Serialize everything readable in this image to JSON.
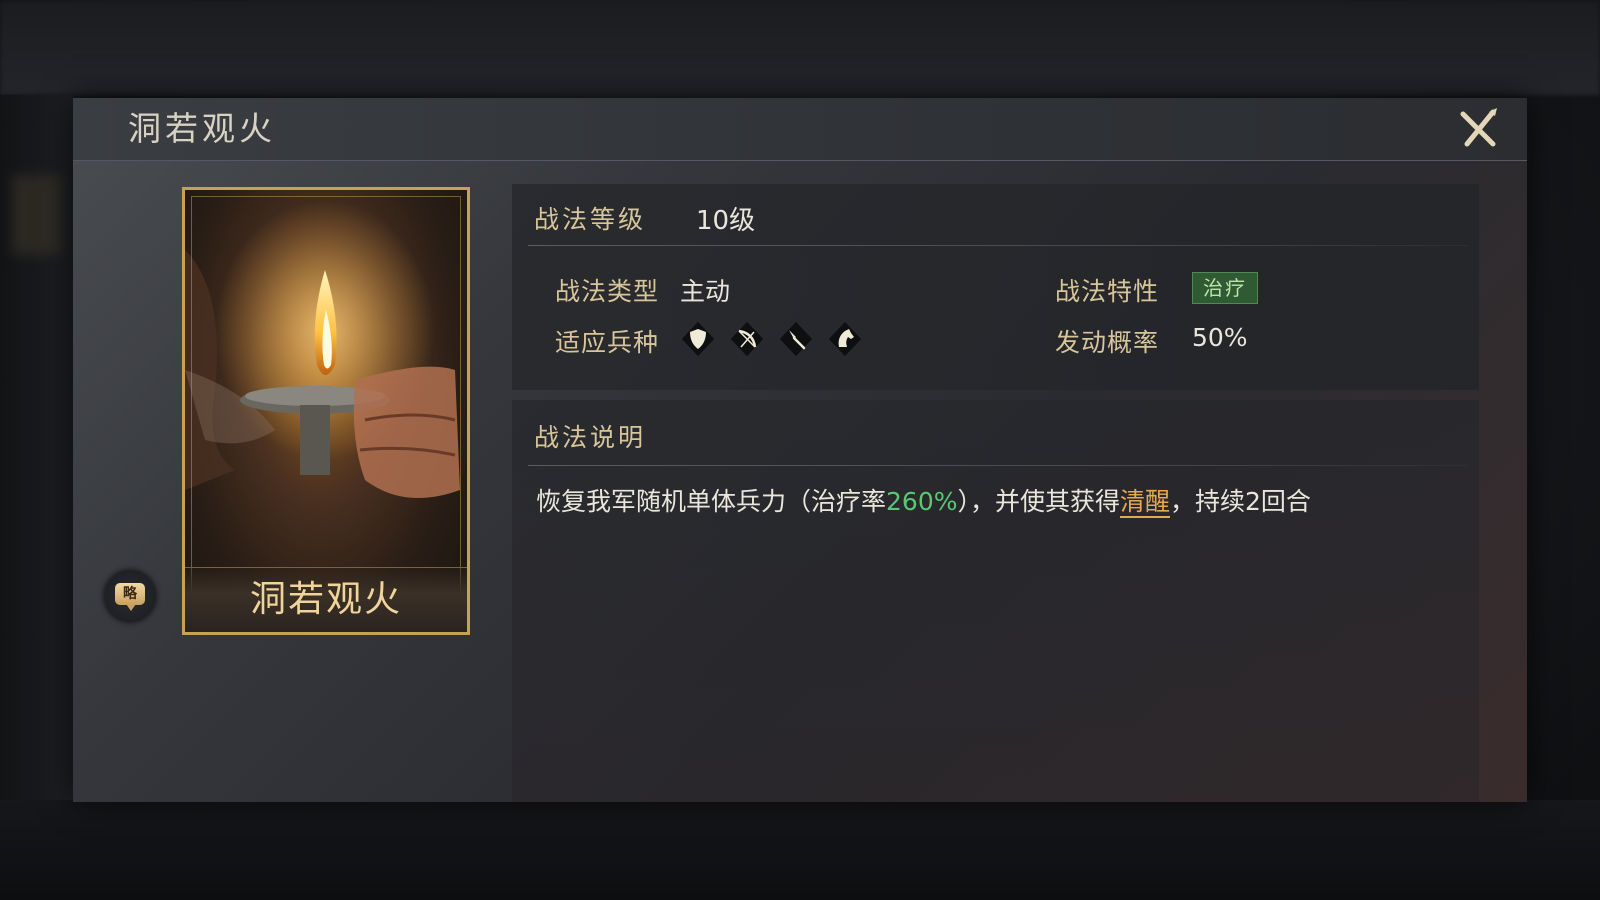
{
  "panel": {
    "title": "洞若观火"
  },
  "card": {
    "name": "洞若观火",
    "badge": "略"
  },
  "info": {
    "level_label": "战法等级",
    "level_value": "10级",
    "type_label": "战法类型",
    "type_value": "主动",
    "trait_label": "战法特性",
    "trait_value": "治疗",
    "units_label": "适应兵种",
    "units": [
      "shield-icon",
      "bow-icon",
      "spear-icon",
      "horse-icon"
    ],
    "chance_label": "发动概率",
    "chance_value": "50%"
  },
  "description": {
    "label": "战法说明",
    "part1": "恢复我军随机单体兵力（治疗率",
    "heal_rate": "260%",
    "part2": "），并使其获得",
    "status": "清醒",
    "part3": "，持续2回合"
  },
  "colors": {
    "gold": "#d8c69a",
    "green": "#58c872",
    "orange": "#e8a850",
    "tag_bg": "#2f5a34"
  }
}
